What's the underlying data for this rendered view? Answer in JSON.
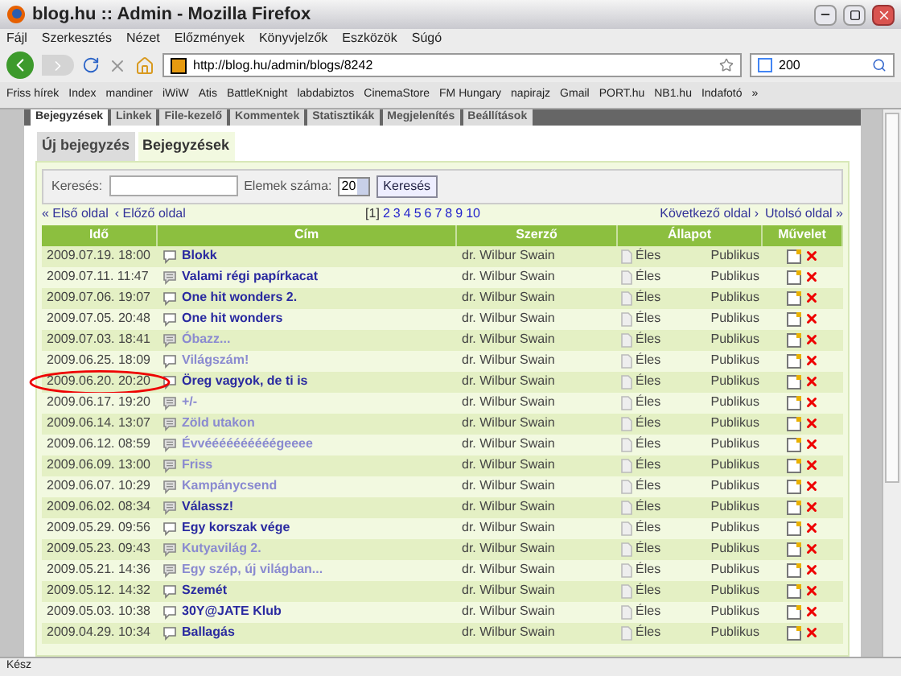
{
  "window": {
    "title": "blog.hu :: Admin - Mozilla Firefox"
  },
  "menu": [
    "Fájl",
    "Szerkesztés",
    "Nézet",
    "Előzmények",
    "Könyvjelzők",
    "Eszközök",
    "Súgó"
  ],
  "toolbar": {
    "url": "http://blog.hu/admin/blogs/8242",
    "search_value": "200"
  },
  "bookmarks": [
    "Friss hírek",
    "Index",
    "mandiner",
    "iWiW",
    "Atis",
    "BattleKnight",
    "labdabiztos",
    "CinemaStore",
    "FM Hungary",
    "napirajz",
    "Gmail",
    "PORT.hu",
    "NB1.hu",
    "Indafotó",
    "»"
  ],
  "admin_tabs": [
    {
      "label": "Bejegyzések",
      "selected": true
    },
    {
      "label": "Linkek",
      "selected": false
    },
    {
      "label": "File-kezelő",
      "selected": false
    },
    {
      "label": "Kommentek",
      "selected": false
    },
    {
      "label": "Statisztikák",
      "selected": false
    },
    {
      "label": "Megjelenítés",
      "selected": false
    },
    {
      "label": "Beállítások",
      "selected": false
    }
  ],
  "sub_tabs": [
    {
      "label": "Új bejegyzés",
      "selected": false
    },
    {
      "label": "Bejegyzések",
      "selected": true
    }
  ],
  "search": {
    "label": "Keresés:",
    "count_label": "Elemek száma:",
    "count_value": "20",
    "button": "Keresés"
  },
  "pagination": {
    "first": "« Első oldal",
    "prev": "‹ Előző oldal",
    "next": "Következő oldal ›",
    "last": "Utolsó oldal »",
    "pages": [
      {
        "label": "[1]",
        "selected": true
      },
      {
        "label": "2",
        "selected": false
      },
      {
        "label": "3",
        "selected": false
      },
      {
        "label": "4",
        "selected": false
      },
      {
        "label": "5",
        "selected": false
      },
      {
        "label": "6",
        "selected": false
      },
      {
        "label": "7",
        "selected": false
      },
      {
        "label": "8",
        "selected": false
      },
      {
        "label": "9",
        "selected": false
      },
      {
        "label": "10",
        "selected": false
      }
    ]
  },
  "table": {
    "columns": [
      "Idő",
      "Cím",
      "Szerző",
      "Állapot",
      "Művelet"
    ],
    "rows": [
      {
        "date": "2009.07.19. 18:00",
        "title": "Blokk",
        "kind": "bubble",
        "faded": false,
        "author": "dr. Wilbur Swain",
        "status": "Éles",
        "visibility": "Publikus",
        "circled": false
      },
      {
        "date": "2009.07.11. 11:47",
        "title": "Valami régi papírkacat",
        "kind": "list",
        "faded": false,
        "author": "dr. Wilbur Swain",
        "status": "Éles",
        "visibility": "Publikus",
        "circled": false
      },
      {
        "date": "2009.07.06. 19:07",
        "title": "One hit wonders 2.",
        "kind": "bubble",
        "faded": false,
        "author": "dr. Wilbur Swain",
        "status": "Éles",
        "visibility": "Publikus",
        "circled": false
      },
      {
        "date": "2009.07.05. 20:48",
        "title": "One hit wonders",
        "kind": "bubble",
        "faded": false,
        "author": "dr. Wilbur Swain",
        "status": "Éles",
        "visibility": "Publikus",
        "circled": false
      },
      {
        "date": "2009.07.03. 18:41",
        "title": "Óbazz...",
        "kind": "list",
        "faded": true,
        "author": "dr. Wilbur Swain",
        "status": "Éles",
        "visibility": "Publikus",
        "circled": false
      },
      {
        "date": "2009.06.25. 18:09",
        "title": "Világszám!",
        "kind": "bubble",
        "faded": true,
        "author": "dr. Wilbur Swain",
        "status": "Éles",
        "visibility": "Publikus",
        "circled": false
      },
      {
        "date": "2009.06.20. 20:20",
        "title": "Öreg vagyok, de ti is",
        "kind": "bubble",
        "faded": false,
        "author": "dr. Wilbur Swain",
        "status": "Éles",
        "visibility": "Publikus",
        "circled": true
      },
      {
        "date": "2009.06.17. 19:20",
        "title": "+/-",
        "kind": "list",
        "faded": true,
        "author": "dr. Wilbur Swain",
        "status": "Éles",
        "visibility": "Publikus",
        "circled": false
      },
      {
        "date": "2009.06.14. 13:07",
        "title": "Zöld utakon",
        "kind": "list",
        "faded": true,
        "author": "dr. Wilbur Swain",
        "status": "Éles",
        "visibility": "Publikus",
        "circled": false
      },
      {
        "date": "2009.06.12. 08:59",
        "title": "Évvéééééééééégeeee",
        "kind": "list",
        "faded": true,
        "author": "dr. Wilbur Swain",
        "status": "Éles",
        "visibility": "Publikus",
        "circled": false
      },
      {
        "date": "2009.06.09. 13:00",
        "title": "Friss",
        "kind": "list",
        "faded": true,
        "author": "dr. Wilbur Swain",
        "status": "Éles",
        "visibility": "Publikus",
        "circled": false
      },
      {
        "date": "2009.06.07. 10:29",
        "title": "Kampánycsend",
        "kind": "list",
        "faded": true,
        "author": "dr. Wilbur Swain",
        "status": "Éles",
        "visibility": "Publikus",
        "circled": false
      },
      {
        "date": "2009.06.02. 08:34",
        "title": "Válassz!",
        "kind": "list",
        "faded": false,
        "author": "dr. Wilbur Swain",
        "status": "Éles",
        "visibility": "Publikus",
        "circled": false
      },
      {
        "date": "2009.05.29. 09:56",
        "title": "Egy korszak vége",
        "kind": "bubble",
        "faded": false,
        "author": "dr. Wilbur Swain",
        "status": "Éles",
        "visibility": "Publikus",
        "circled": false
      },
      {
        "date": "2009.05.23. 09:43",
        "title": "Kutyavilág 2.",
        "kind": "list",
        "faded": true,
        "author": "dr. Wilbur Swain",
        "status": "Éles",
        "visibility": "Publikus",
        "circled": false
      },
      {
        "date": "2009.05.21. 14:36",
        "title": "Egy szép, új világban...",
        "kind": "list",
        "faded": true,
        "author": "dr. Wilbur Swain",
        "status": "Éles",
        "visibility": "Publikus",
        "circled": false
      },
      {
        "date": "2009.05.12. 14:32",
        "title": "Szemét",
        "kind": "bubble",
        "faded": false,
        "author": "dr. Wilbur Swain",
        "status": "Éles",
        "visibility": "Publikus",
        "circled": false
      },
      {
        "date": "2009.05.03. 10:38",
        "title": "30Y@JATE Klub",
        "kind": "bubble",
        "faded": false,
        "author": "dr. Wilbur Swain",
        "status": "Éles",
        "visibility": "Publikus",
        "circled": false
      },
      {
        "date": "2009.04.29. 10:34",
        "title": "Ballagás",
        "kind": "bubble",
        "faded": false,
        "author": "dr. Wilbur Swain",
        "status": "Éles",
        "visibility": "Publikus",
        "circled": false
      }
    ]
  },
  "status_bar": "Kész"
}
